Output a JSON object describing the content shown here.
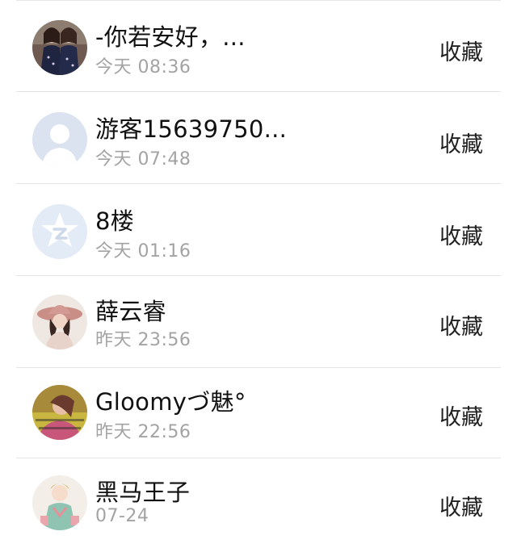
{
  "items": [
    {
      "name": "-你若安好，...",
      "time": "今天 08:36",
      "action": "收藏",
      "avatar": "photo-avatar-two-girls"
    },
    {
      "name": "游客15639750...",
      "time": "今天 07:48",
      "action": "收藏",
      "avatar": "default-person-avatar"
    },
    {
      "name": "8楼",
      "time": "今天 01:16",
      "action": "收藏",
      "avatar": "star-badge-avatar"
    },
    {
      "name": "薛云睿",
      "time": "昨天 23:56",
      "action": "收藏",
      "avatar": "photo-avatar-girl-hat"
    },
    {
      "name": "Gloomyづ魅°",
      "time": "昨天 22:56",
      "action": "收藏",
      "avatar": "photo-avatar-girl-yellow"
    },
    {
      "name": "黑马王子",
      "time": "07-24",
      "action": "收藏",
      "avatar": "photo-avatar-illustration"
    }
  ],
  "colors": {
    "name": "#111111",
    "time": "#a3a3a3",
    "separator": "#e4e4e4",
    "default_avatar_bg": "#dbe3f0"
  }
}
